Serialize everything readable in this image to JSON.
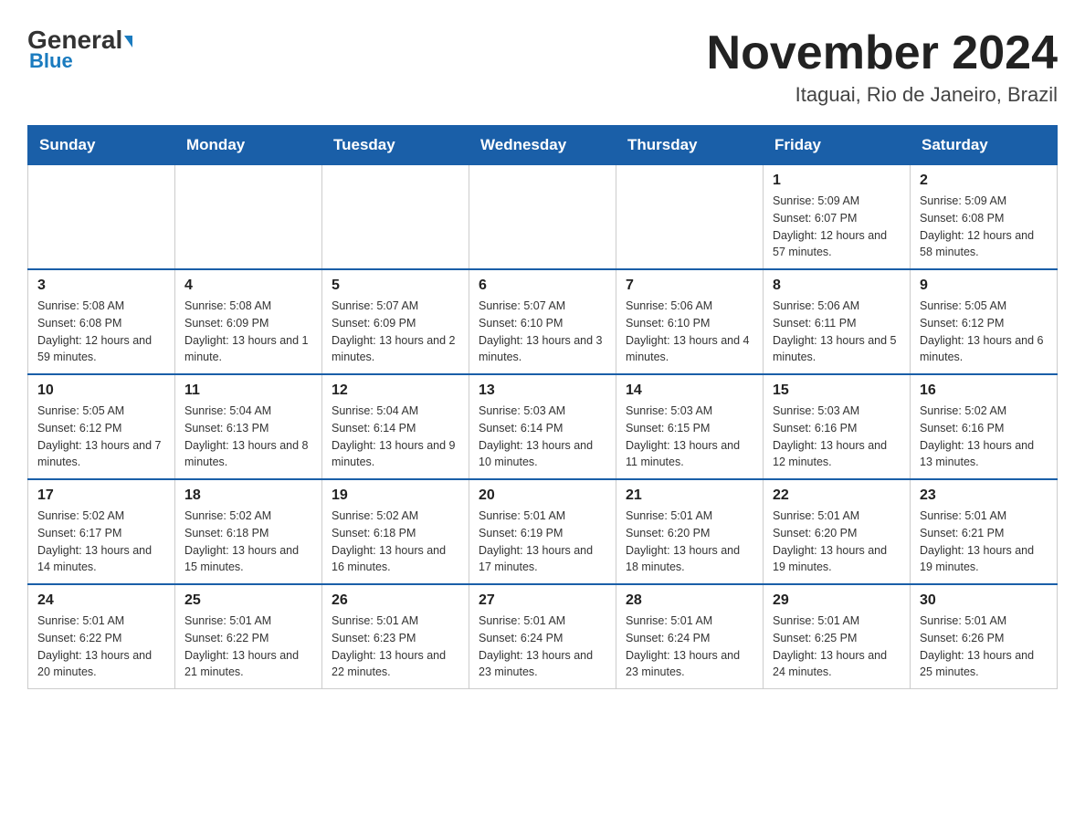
{
  "header": {
    "logo": {
      "general": "General",
      "blue": "Blue"
    },
    "title": "November 2024",
    "location": "Itaguai, Rio de Janeiro, Brazil"
  },
  "days_of_week": [
    "Sunday",
    "Monday",
    "Tuesday",
    "Wednesday",
    "Thursday",
    "Friday",
    "Saturday"
  ],
  "weeks": [
    [
      {
        "day": "",
        "info": ""
      },
      {
        "day": "",
        "info": ""
      },
      {
        "day": "",
        "info": ""
      },
      {
        "day": "",
        "info": ""
      },
      {
        "day": "",
        "info": ""
      },
      {
        "day": "1",
        "info": "Sunrise: 5:09 AM\nSunset: 6:07 PM\nDaylight: 12 hours and 57 minutes."
      },
      {
        "day": "2",
        "info": "Sunrise: 5:09 AM\nSunset: 6:08 PM\nDaylight: 12 hours and 58 minutes."
      }
    ],
    [
      {
        "day": "3",
        "info": "Sunrise: 5:08 AM\nSunset: 6:08 PM\nDaylight: 12 hours and 59 minutes."
      },
      {
        "day": "4",
        "info": "Sunrise: 5:08 AM\nSunset: 6:09 PM\nDaylight: 13 hours and 1 minute."
      },
      {
        "day": "5",
        "info": "Sunrise: 5:07 AM\nSunset: 6:09 PM\nDaylight: 13 hours and 2 minutes."
      },
      {
        "day": "6",
        "info": "Sunrise: 5:07 AM\nSunset: 6:10 PM\nDaylight: 13 hours and 3 minutes."
      },
      {
        "day": "7",
        "info": "Sunrise: 5:06 AM\nSunset: 6:10 PM\nDaylight: 13 hours and 4 minutes."
      },
      {
        "day": "8",
        "info": "Sunrise: 5:06 AM\nSunset: 6:11 PM\nDaylight: 13 hours and 5 minutes."
      },
      {
        "day": "9",
        "info": "Sunrise: 5:05 AM\nSunset: 6:12 PM\nDaylight: 13 hours and 6 minutes."
      }
    ],
    [
      {
        "day": "10",
        "info": "Sunrise: 5:05 AM\nSunset: 6:12 PM\nDaylight: 13 hours and 7 minutes."
      },
      {
        "day": "11",
        "info": "Sunrise: 5:04 AM\nSunset: 6:13 PM\nDaylight: 13 hours and 8 minutes."
      },
      {
        "day": "12",
        "info": "Sunrise: 5:04 AM\nSunset: 6:14 PM\nDaylight: 13 hours and 9 minutes."
      },
      {
        "day": "13",
        "info": "Sunrise: 5:03 AM\nSunset: 6:14 PM\nDaylight: 13 hours and 10 minutes."
      },
      {
        "day": "14",
        "info": "Sunrise: 5:03 AM\nSunset: 6:15 PM\nDaylight: 13 hours and 11 minutes."
      },
      {
        "day": "15",
        "info": "Sunrise: 5:03 AM\nSunset: 6:16 PM\nDaylight: 13 hours and 12 minutes."
      },
      {
        "day": "16",
        "info": "Sunrise: 5:02 AM\nSunset: 6:16 PM\nDaylight: 13 hours and 13 minutes."
      }
    ],
    [
      {
        "day": "17",
        "info": "Sunrise: 5:02 AM\nSunset: 6:17 PM\nDaylight: 13 hours and 14 minutes."
      },
      {
        "day": "18",
        "info": "Sunrise: 5:02 AM\nSunset: 6:18 PM\nDaylight: 13 hours and 15 minutes."
      },
      {
        "day": "19",
        "info": "Sunrise: 5:02 AM\nSunset: 6:18 PM\nDaylight: 13 hours and 16 minutes."
      },
      {
        "day": "20",
        "info": "Sunrise: 5:01 AM\nSunset: 6:19 PM\nDaylight: 13 hours and 17 minutes."
      },
      {
        "day": "21",
        "info": "Sunrise: 5:01 AM\nSunset: 6:20 PM\nDaylight: 13 hours and 18 minutes."
      },
      {
        "day": "22",
        "info": "Sunrise: 5:01 AM\nSunset: 6:20 PM\nDaylight: 13 hours and 19 minutes."
      },
      {
        "day": "23",
        "info": "Sunrise: 5:01 AM\nSunset: 6:21 PM\nDaylight: 13 hours and 19 minutes."
      }
    ],
    [
      {
        "day": "24",
        "info": "Sunrise: 5:01 AM\nSunset: 6:22 PM\nDaylight: 13 hours and 20 minutes."
      },
      {
        "day": "25",
        "info": "Sunrise: 5:01 AM\nSunset: 6:22 PM\nDaylight: 13 hours and 21 minutes."
      },
      {
        "day": "26",
        "info": "Sunrise: 5:01 AM\nSunset: 6:23 PM\nDaylight: 13 hours and 22 minutes."
      },
      {
        "day": "27",
        "info": "Sunrise: 5:01 AM\nSunset: 6:24 PM\nDaylight: 13 hours and 23 minutes."
      },
      {
        "day": "28",
        "info": "Sunrise: 5:01 AM\nSunset: 6:24 PM\nDaylight: 13 hours and 23 minutes."
      },
      {
        "day": "29",
        "info": "Sunrise: 5:01 AM\nSunset: 6:25 PM\nDaylight: 13 hours and 24 minutes."
      },
      {
        "day": "30",
        "info": "Sunrise: 5:01 AM\nSunset: 6:26 PM\nDaylight: 13 hours and 25 minutes."
      }
    ]
  ]
}
